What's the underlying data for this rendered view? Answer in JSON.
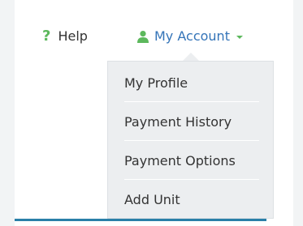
{
  "header": {
    "help_label": "Help",
    "help_icon": "?",
    "account_label": "My Account"
  },
  "menu": {
    "items": [
      {
        "label": "My Profile"
      },
      {
        "label": "Payment History"
      },
      {
        "label": "Payment Options"
      },
      {
        "label": "Add Unit"
      }
    ]
  },
  "colors": {
    "accent_green": "#5cb85c",
    "link_blue": "#3474b8",
    "underline_blue": "#2a7fa8"
  },
  "icons": {
    "help": "question-mark-icon",
    "account": "user-icon",
    "dropdown_caret": "caret-down-icon"
  }
}
